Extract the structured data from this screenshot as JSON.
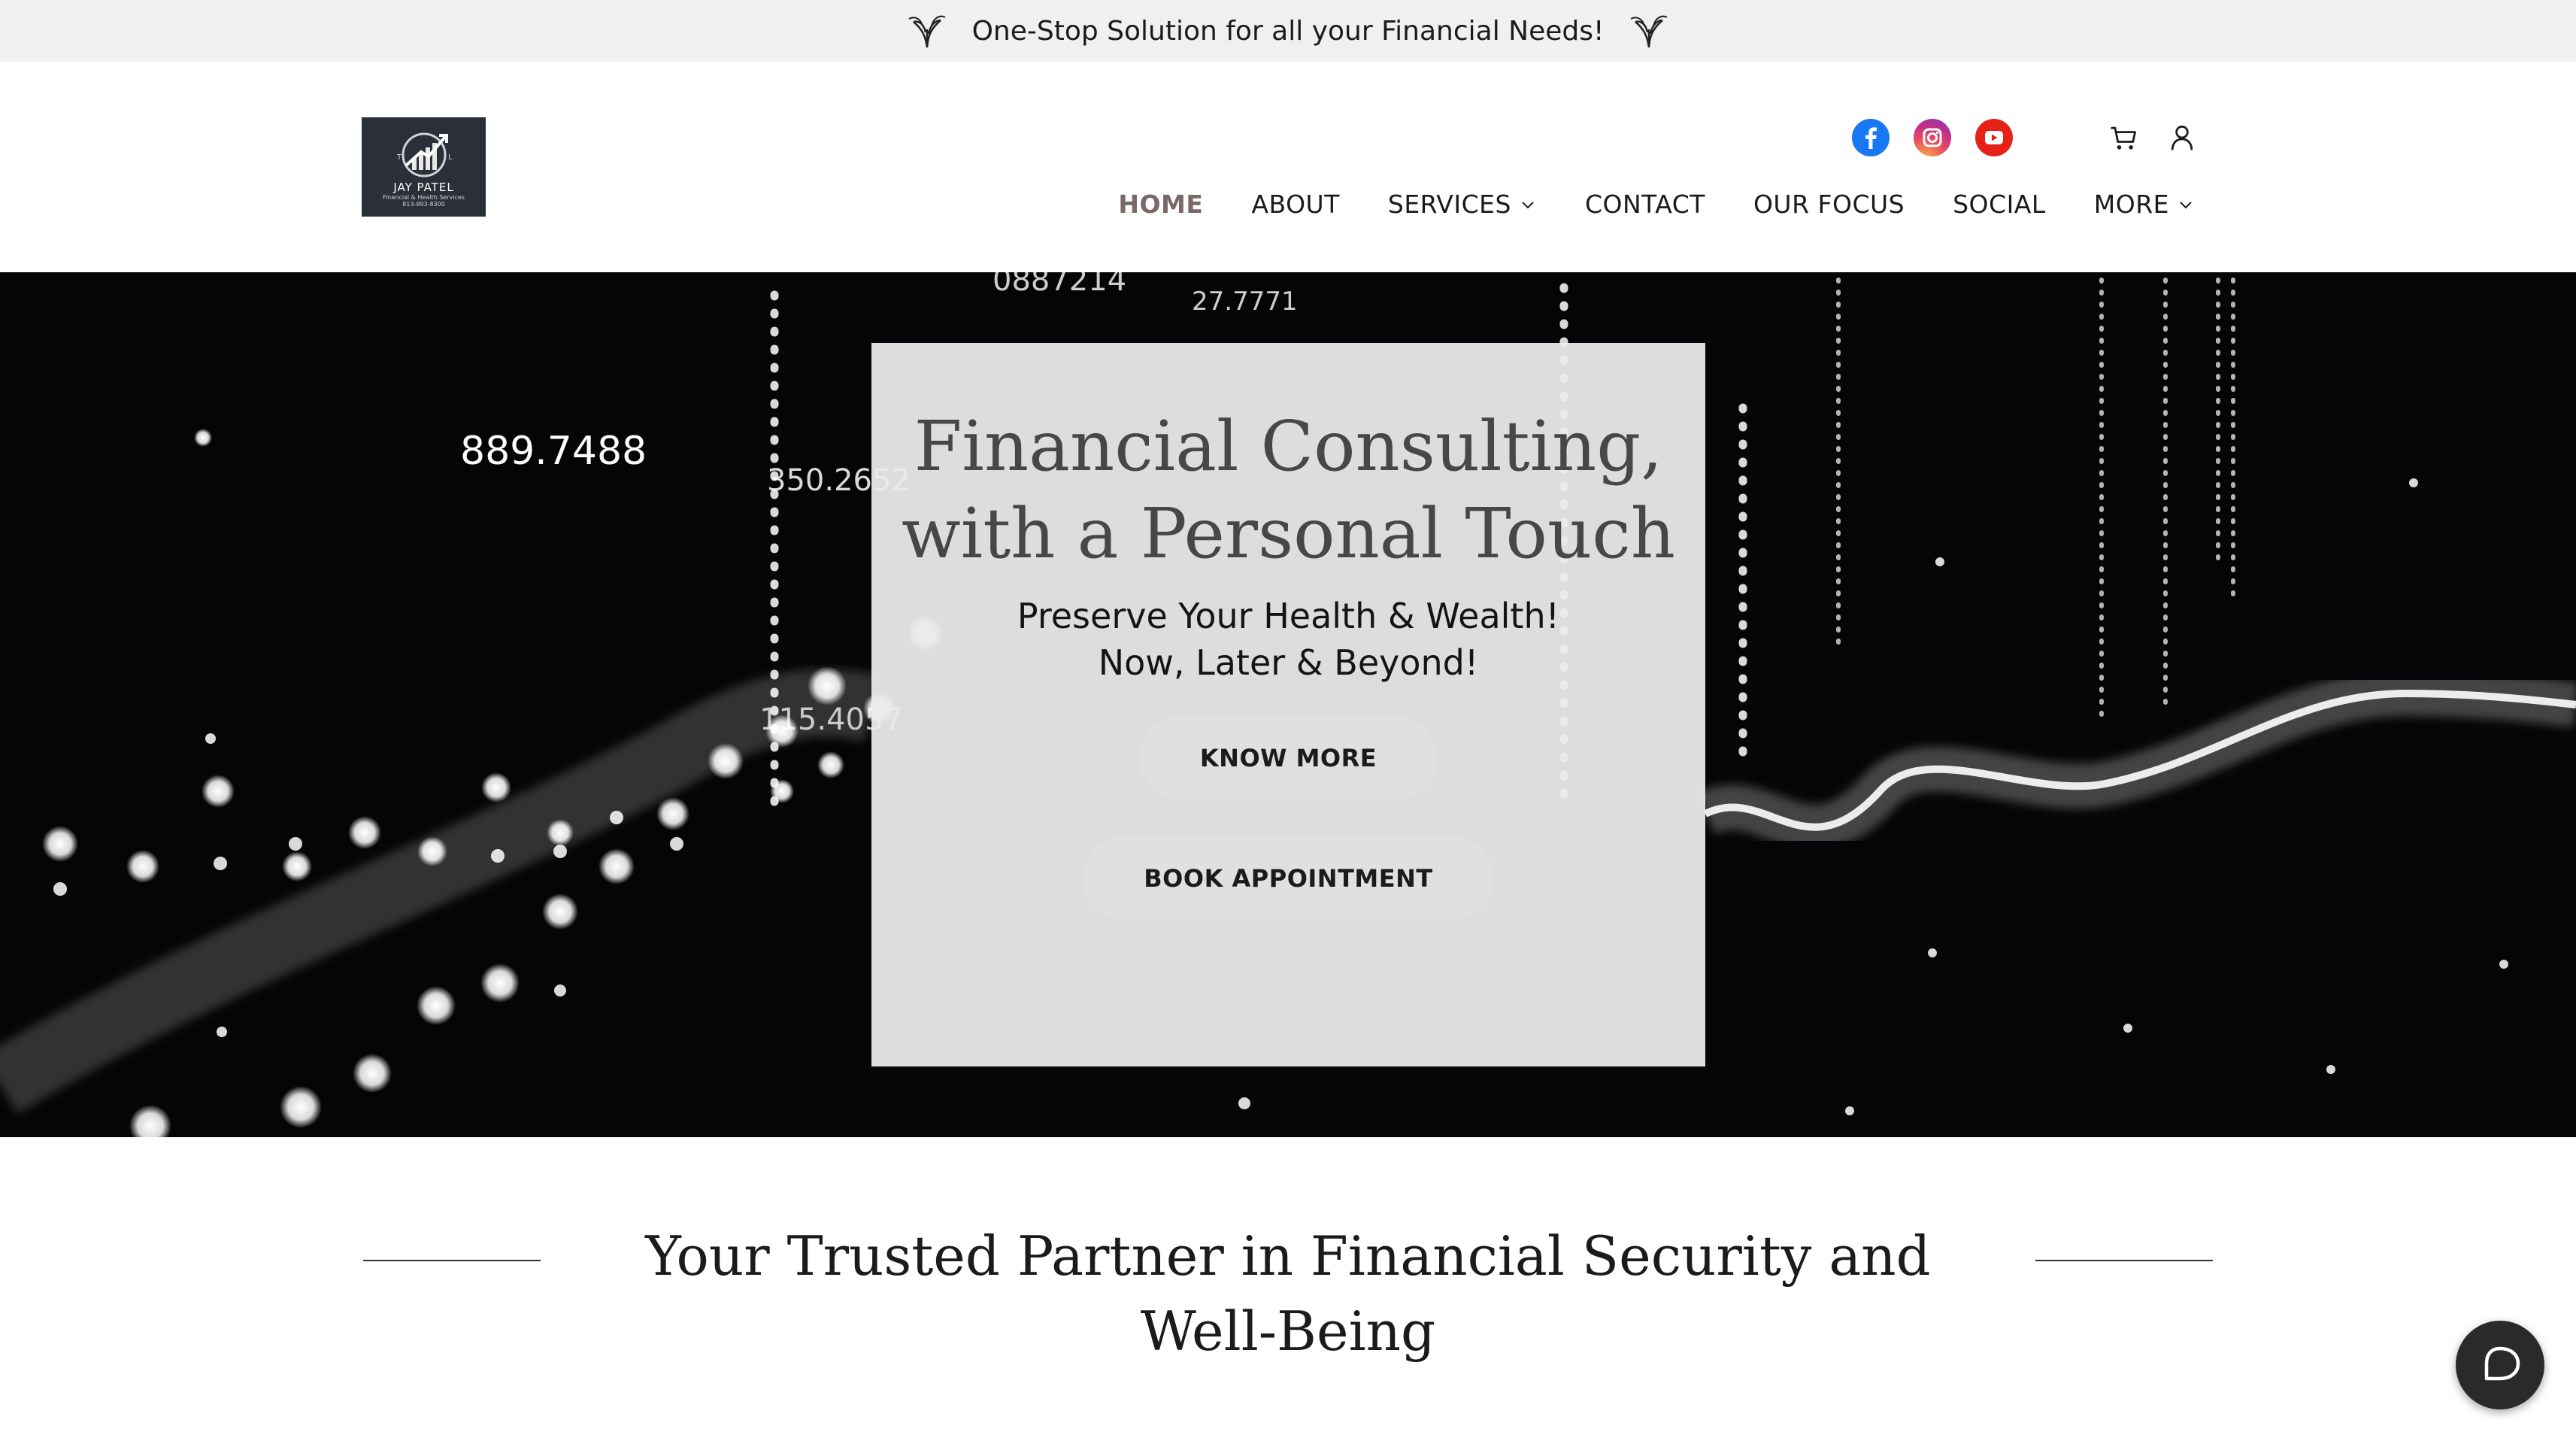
{
  "announcement": {
    "text": "One-Stop Solution for all your Financial Needs!"
  },
  "logo": {
    "name": "JAY PATEL",
    "tagline": "Financial & Health Services",
    "phone": "813-893-8300"
  },
  "header": {
    "social": [
      "facebook-icon",
      "instagram-icon",
      "youtube-icon"
    ],
    "tools": [
      "cart-icon",
      "account-icon"
    ],
    "nav": [
      {
        "label": "HOME",
        "active": true
      },
      {
        "label": "ABOUT"
      },
      {
        "label": "SERVICES",
        "has_dropdown": true
      },
      {
        "label": "CONTACT"
      },
      {
        "label": "OUR FOCUS"
      },
      {
        "label": "SOCIAL"
      },
      {
        "label": "MORE",
        "has_dropdown": true
      }
    ]
  },
  "hero": {
    "background_numbers": [
      "889.7488",
      "350.2652",
      "115.4057",
      "0887214",
      "27.7771"
    ],
    "title": "Financial Consulting, with a Personal Touch",
    "subtitle_line1": "Preserve Your Health & Wealth!",
    "subtitle_line2": "Now, Later & Beyond!",
    "buttons": {
      "primary": "KNOW MORE",
      "secondary": "BOOK APPOINTMENT"
    }
  },
  "section": {
    "heading": "Your Trusted Partner in Financial Security and Well-Being"
  },
  "colors": {
    "topbar_bg": "#f0f0f0",
    "active_nav": "#7b6868",
    "hero_bg": "#050507",
    "card_bg": "#ebebeb",
    "chat_bg": "#2a2a2a"
  }
}
